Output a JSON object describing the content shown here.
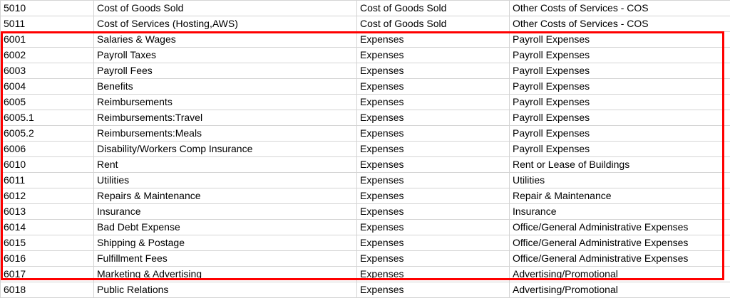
{
  "spreadsheet": {
    "rows": [
      {
        "code": "5010",
        "name": "Cost of Goods Sold",
        "type": "Cost of Goods Sold",
        "detail": "Other Costs of Services - COS"
      },
      {
        "code": "5011",
        "name": "Cost of Services (Hosting,AWS)",
        "type": "Cost of Goods Sold",
        "detail": "Other Costs of Services - COS"
      },
      {
        "code": "6001",
        "name": "Salaries & Wages",
        "type": "Expenses",
        "detail": "Payroll Expenses"
      },
      {
        "code": "6002",
        "name": "Payroll Taxes",
        "type": "Expenses",
        "detail": "Payroll Expenses"
      },
      {
        "code": "6003",
        "name": "Payroll Fees",
        "type": "Expenses",
        "detail": "Payroll Expenses"
      },
      {
        "code": "6004",
        "name": "Benefits",
        "type": "Expenses",
        "detail": "Payroll Expenses"
      },
      {
        "code": "6005",
        "name": "Reimbursements",
        "type": "Expenses",
        "detail": "Payroll Expenses"
      },
      {
        "code": "6005.1",
        "name": "Reimbursements:Travel",
        "type": "Expenses",
        "detail": "Payroll Expenses"
      },
      {
        "code": "6005.2",
        "name": "Reimbursements:Meals",
        "type": "Expenses",
        "detail": "Payroll Expenses"
      },
      {
        "code": "6006",
        "name": "Disability/Workers Comp Insurance",
        "type": "Expenses",
        "detail": "Payroll Expenses"
      },
      {
        "code": "6010",
        "name": "Rent",
        "type": "Expenses",
        "detail": "Rent or Lease of Buildings"
      },
      {
        "code": "6011",
        "name": "Utilities",
        "type": "Expenses",
        "detail": "Utilities"
      },
      {
        "code": "6012",
        "name": "Repairs & Maintenance",
        "type": "Expenses",
        "detail": "Repair & Maintenance"
      },
      {
        "code": "6013",
        "name": "Insurance",
        "type": "Expenses",
        "detail": "Insurance"
      },
      {
        "code": "6014",
        "name": "Bad Debt Expense",
        "type": "Expenses",
        "detail": "Office/General Administrative Expenses"
      },
      {
        "code": "6015",
        "name": "Shipping & Postage",
        "type": "Expenses",
        "detail": "Office/General Administrative Expenses"
      },
      {
        "code": "6016",
        "name": "Fulfillment Fees",
        "type": "Expenses",
        "detail": "Office/General Administrative Expenses"
      },
      {
        "code": "6017",
        "name": "Marketing & Advertising",
        "type": "Expenses",
        "detail": "Advertising/Promotional"
      },
      {
        "code": "6018",
        "name": "Public Relations",
        "type": "Expenses",
        "detail": "Advertising/Promotional"
      }
    ]
  },
  "colors": {
    "highlight_border": "#ff0000",
    "grid_line": "#d4d4d4"
  }
}
